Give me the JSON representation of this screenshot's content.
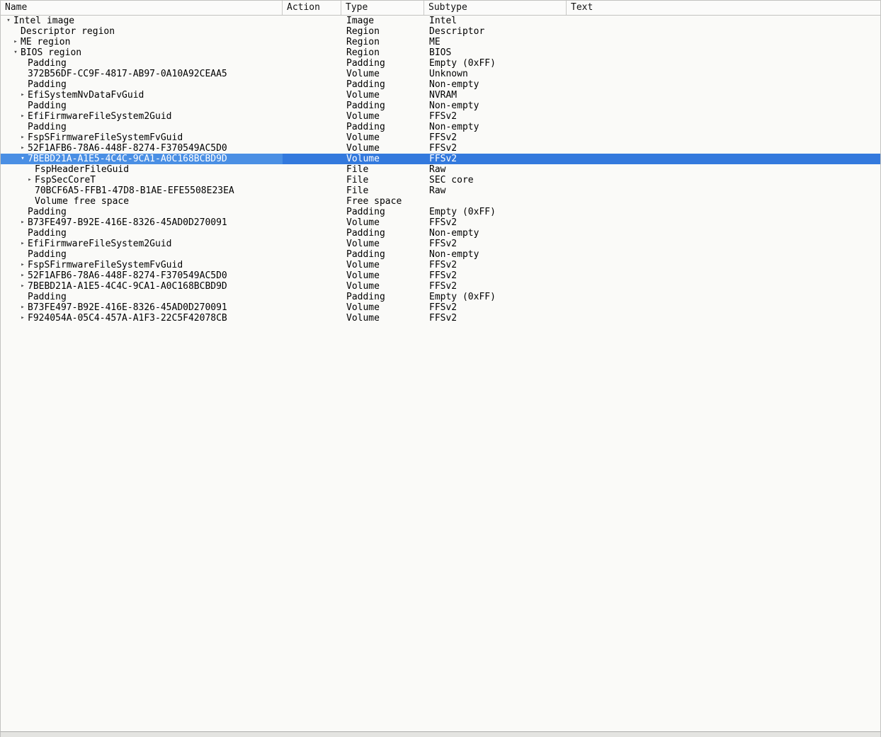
{
  "colors": {
    "background": "#fafaf8",
    "header_background": "#fbfbfa",
    "border": "#c2c2c0",
    "selection_row": "#3379dd",
    "selection_cell": "#4a8fe4",
    "selection_text": "#ffffff",
    "arrow": "#4a4a4a",
    "text": "#000000"
  },
  "icons": {
    "expander_open": "▾",
    "expander_closed": "▸"
  },
  "table": {
    "columns": [
      {
        "label": "Name"
      },
      {
        "label": "Action"
      },
      {
        "label": "Type"
      },
      {
        "label": "Subtype"
      },
      {
        "label": "Text"
      }
    ],
    "rows": [
      {
        "name": "Intel image",
        "level": 0,
        "expander": "open",
        "action": "",
        "type": "Image",
        "subtype": "Intel",
        "text": "",
        "selected": false
      },
      {
        "name": "Descriptor region",
        "level": 1,
        "expander": "none",
        "action": "",
        "type": "Region",
        "subtype": "Descriptor",
        "text": "",
        "selected": false
      },
      {
        "name": "ME region",
        "level": 1,
        "expander": "closed",
        "action": "",
        "type": "Region",
        "subtype": "ME",
        "text": "",
        "selected": false
      },
      {
        "name": "BIOS region",
        "level": 1,
        "expander": "open",
        "action": "",
        "type": "Region",
        "subtype": "BIOS",
        "text": "",
        "selected": false
      },
      {
        "name": "Padding",
        "level": 2,
        "expander": "none",
        "action": "",
        "type": "Padding",
        "subtype": "Empty (0xFF)",
        "text": "",
        "selected": false
      },
      {
        "name": "372B56DF-CC9F-4817-AB97-0A10A92CEAA5",
        "level": 2,
        "expander": "none",
        "action": "",
        "type": "Volume",
        "subtype": "Unknown",
        "text": "",
        "selected": false
      },
      {
        "name": "Padding",
        "level": 2,
        "expander": "none",
        "action": "",
        "type": "Padding",
        "subtype": "Non-empty",
        "text": "",
        "selected": false
      },
      {
        "name": "EfiSystemNvDataFvGuid",
        "level": 2,
        "expander": "closed",
        "action": "",
        "type": "Volume",
        "subtype": "NVRAM",
        "text": "",
        "selected": false
      },
      {
        "name": "Padding",
        "level": 2,
        "expander": "none",
        "action": "",
        "type": "Padding",
        "subtype": "Non-empty",
        "text": "",
        "selected": false
      },
      {
        "name": "EfiFirmwareFileSystem2Guid",
        "level": 2,
        "expander": "closed",
        "action": "",
        "type": "Volume",
        "subtype": "FFSv2",
        "text": "",
        "selected": false
      },
      {
        "name": "Padding",
        "level": 2,
        "expander": "none",
        "action": "",
        "type": "Padding",
        "subtype": "Non-empty",
        "text": "",
        "selected": false
      },
      {
        "name": "FspSFirmwareFileSystemFvGuid",
        "level": 2,
        "expander": "closed",
        "action": "",
        "type": "Volume",
        "subtype": "FFSv2",
        "text": "",
        "selected": false
      },
      {
        "name": "52F1AFB6-78A6-448F-8274-F370549AC5D0",
        "level": 2,
        "expander": "closed",
        "action": "",
        "type": "Volume",
        "subtype": "FFSv2",
        "text": "",
        "selected": false
      },
      {
        "name": "7BEBD21A-A1E5-4C4C-9CA1-A0C168BCBD9D",
        "level": 2,
        "expander": "open",
        "action": "",
        "type": "Volume",
        "subtype": "FFSv2",
        "text": "",
        "selected": true
      },
      {
        "name": "FspHeaderFileGuid",
        "level": 3,
        "expander": "none",
        "action": "",
        "type": "File",
        "subtype": "Raw",
        "text": "",
        "selected": false
      },
      {
        "name": "FspSecCoreT",
        "level": 3,
        "expander": "closed",
        "action": "",
        "type": "File",
        "subtype": "SEC core",
        "text": "",
        "selected": false
      },
      {
        "name": "70BCF6A5-FFB1-47D8-B1AE-EFE5508E23EA",
        "level": 3,
        "expander": "none",
        "action": "",
        "type": "File",
        "subtype": "Raw",
        "text": "",
        "selected": false
      },
      {
        "name": "Volume free space",
        "level": 3,
        "expander": "none",
        "action": "",
        "type": "Free space",
        "subtype": "",
        "text": "",
        "selected": false
      },
      {
        "name": "Padding",
        "level": 2,
        "expander": "none",
        "action": "",
        "type": "Padding",
        "subtype": "Empty (0xFF)",
        "text": "",
        "selected": false
      },
      {
        "name": "B73FE497-B92E-416E-8326-45AD0D270091",
        "level": 2,
        "expander": "closed",
        "action": "",
        "type": "Volume",
        "subtype": "FFSv2",
        "text": "",
        "selected": false
      },
      {
        "name": "Padding",
        "level": 2,
        "expander": "none",
        "action": "",
        "type": "Padding",
        "subtype": "Non-empty",
        "text": "",
        "selected": false
      },
      {
        "name": "EfiFirmwareFileSystem2Guid",
        "level": 2,
        "expander": "closed",
        "action": "",
        "type": "Volume",
        "subtype": "FFSv2",
        "text": "",
        "selected": false
      },
      {
        "name": "Padding",
        "level": 2,
        "expander": "none",
        "action": "",
        "type": "Padding",
        "subtype": "Non-empty",
        "text": "",
        "selected": false
      },
      {
        "name": "FspSFirmwareFileSystemFvGuid",
        "level": 2,
        "expander": "closed",
        "action": "",
        "type": "Volume",
        "subtype": "FFSv2",
        "text": "",
        "selected": false
      },
      {
        "name": "52F1AFB6-78A6-448F-8274-F370549AC5D0",
        "level": 2,
        "expander": "closed",
        "action": "",
        "type": "Volume",
        "subtype": "FFSv2",
        "text": "",
        "selected": false
      },
      {
        "name": "7BEBD21A-A1E5-4C4C-9CA1-A0C168BCBD9D",
        "level": 2,
        "expander": "closed",
        "action": "",
        "type": "Volume",
        "subtype": "FFSv2",
        "text": "",
        "selected": false
      },
      {
        "name": "Padding",
        "level": 2,
        "expander": "none",
        "action": "",
        "type": "Padding",
        "subtype": "Empty (0xFF)",
        "text": "",
        "selected": false
      },
      {
        "name": "B73FE497-B92E-416E-8326-45AD0D270091",
        "level": 2,
        "expander": "closed",
        "action": "",
        "type": "Volume",
        "subtype": "FFSv2",
        "text": "",
        "selected": false
      },
      {
        "name": "F924054A-05C4-457A-A1F3-22C5F42078CB",
        "level": 2,
        "expander": "closed",
        "action": "",
        "type": "Volume",
        "subtype": "FFSv2",
        "text": "",
        "selected": false
      }
    ]
  }
}
